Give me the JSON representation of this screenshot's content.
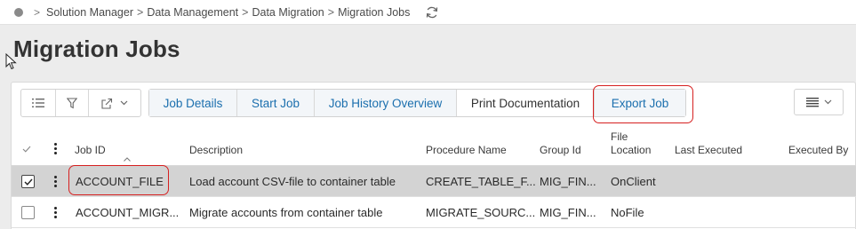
{
  "breadcrumb": {
    "items": [
      "Solution Manager",
      "Data Management",
      "Data Migration",
      "Migration Jobs"
    ],
    "separator": ">"
  },
  "page": {
    "title": "Migration Jobs"
  },
  "toolbar": {
    "commands": [
      "Job Details",
      "Start Job",
      "Job History Overview",
      "Print Documentation",
      "Export Job"
    ]
  },
  "table": {
    "columns": [
      "Job ID",
      "Description",
      "Procedure Name",
      "Group Id",
      "File\nLocation",
      "Last Executed",
      "Executed By"
    ],
    "column_labels": {
      "job_id": "Job ID",
      "description": "Description",
      "procedure_name": "Procedure Name",
      "group_id": "Group Id",
      "file_location_1": "File",
      "file_location_2": "Location",
      "last_executed": "Last Executed",
      "executed_by": "Executed By"
    },
    "rows": [
      {
        "selected": true,
        "job_id": "ACCOUNT_FILE",
        "description": "Load account CSV-file to container table",
        "procedure_name": "CREATE_TABLE_F...",
        "group_id": "MIG_FIN...",
        "file_location": "OnClient",
        "last_executed": "",
        "executed_by": ""
      },
      {
        "selected": false,
        "job_id": "ACCOUNT_MIGR...",
        "description": "Migrate accounts from container table",
        "procedure_name": "MIGRATE_SOURC...",
        "group_id": "MIG_FIN...",
        "file_location": "NoFile",
        "last_executed": "",
        "executed_by": ""
      }
    ]
  },
  "colors": {
    "accent": "#1b6fae",
    "highlight": "#d62020",
    "selected_row": "#d3d3d3"
  }
}
